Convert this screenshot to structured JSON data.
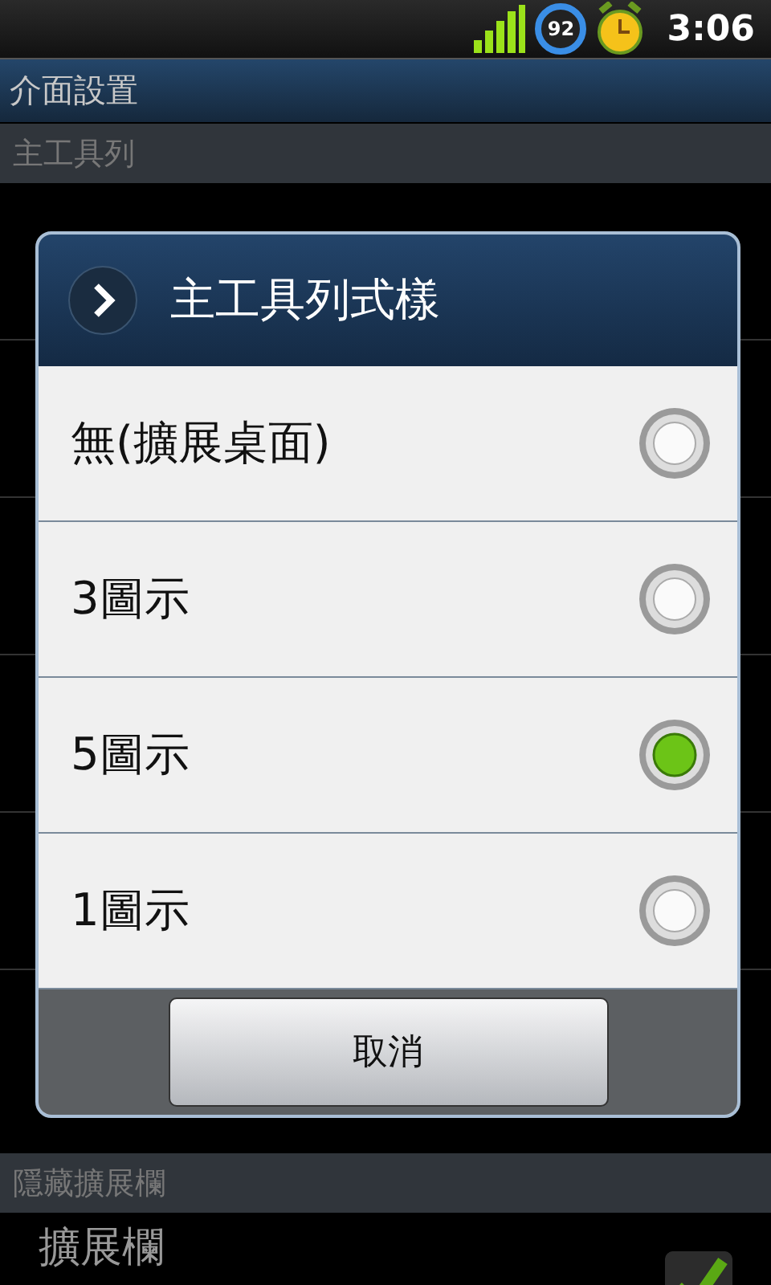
{
  "status_bar": {
    "battery_level_text": "92",
    "time": "3:06"
  },
  "title": "介面設置",
  "sections": [
    {
      "header": "主工具列"
    },
    {
      "header": "隱藏擴展欄",
      "items": [
        {
          "label": "擴展欄",
          "checked": true
        }
      ]
    }
  ],
  "dialog": {
    "title": "主工具列式樣",
    "options": [
      {
        "label": "無(擴展桌面)",
        "selected": false
      },
      {
        "label": "3圖示",
        "selected": false
      },
      {
        "label": "5圖示",
        "selected": true
      },
      {
        "label": "1圖示",
        "selected": false
      }
    ],
    "cancel_button": "取消"
  }
}
